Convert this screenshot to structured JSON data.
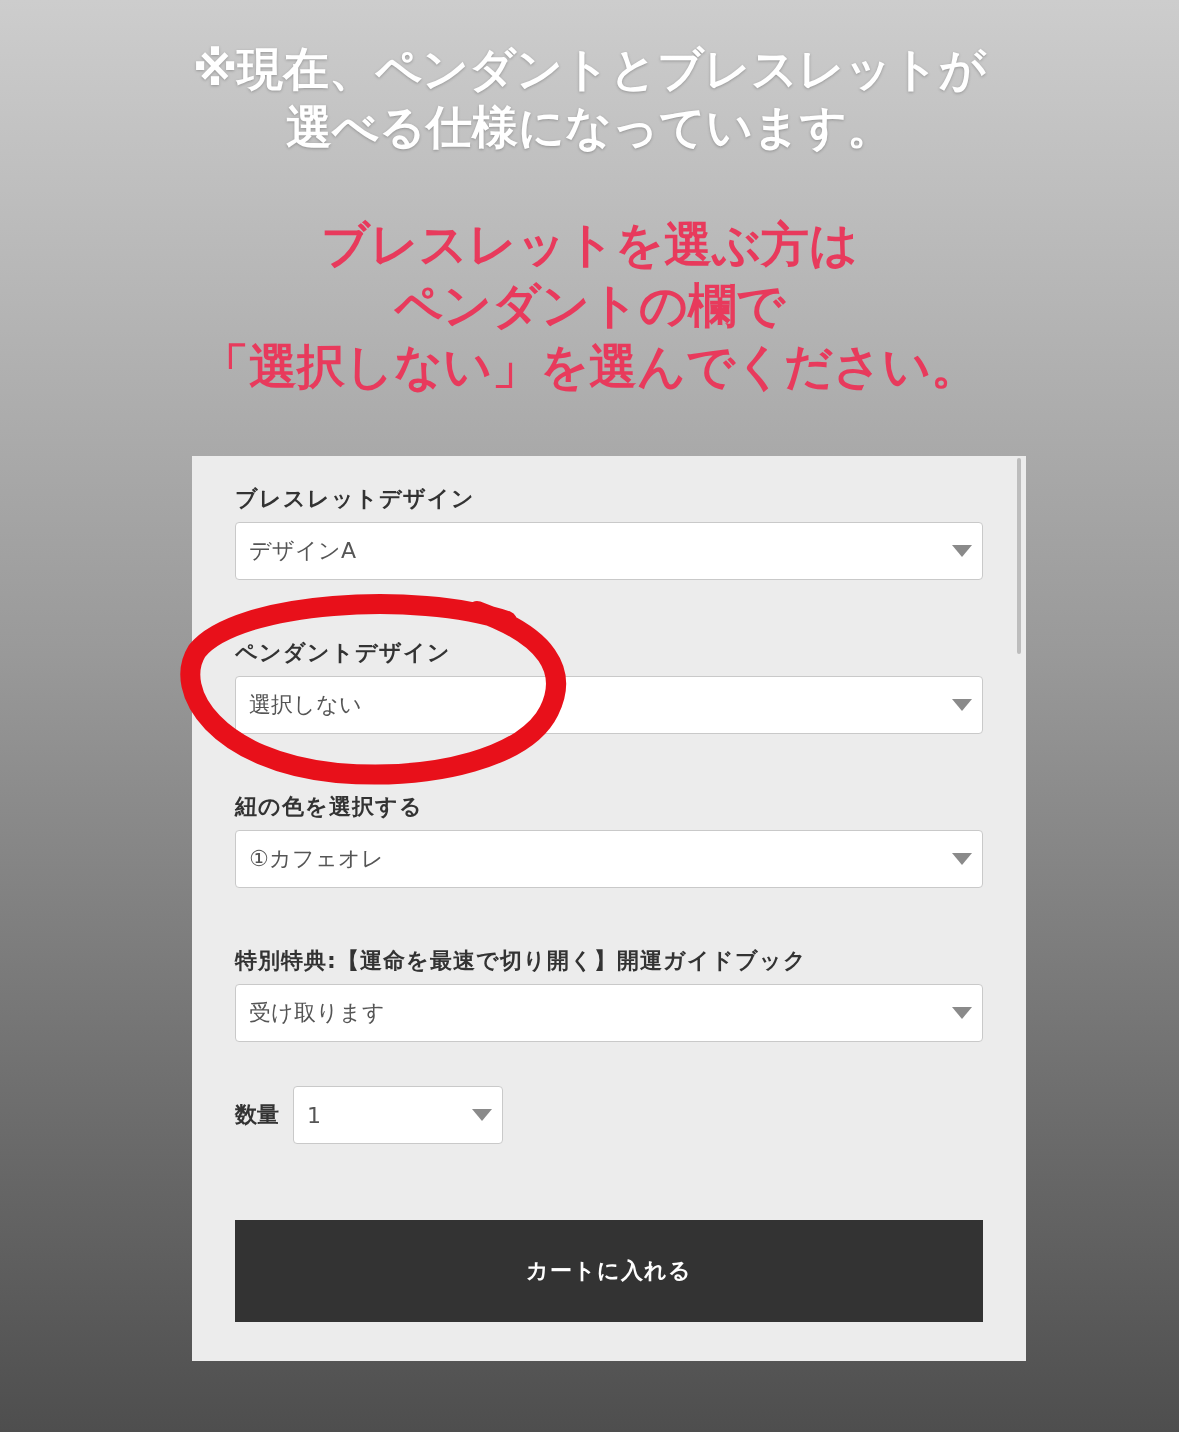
{
  "notice_lines": [
    "※現在、ペンダントとブレスレットが",
    "選べる仕様になっています。"
  ],
  "instruction_lines": [
    "ブレスレットを選ぶ方は",
    "ペンダントの欄で",
    "「選択しない」を選んでください。"
  ],
  "form": {
    "fields": [
      {
        "label": "ブレスレットデザイン",
        "value": "デザインA"
      },
      {
        "label": "ペンダントデザイン",
        "value": "選択しない"
      },
      {
        "label": "紐の色を選択する",
        "value": "①カフェオレ"
      },
      {
        "label": "特別特典:【運命を最速で切り開く】開運ガイドブック",
        "value": "受け取ります"
      }
    ],
    "quantity": {
      "label": "数量",
      "value": "1"
    },
    "cart_button": "カートに入れる"
  }
}
